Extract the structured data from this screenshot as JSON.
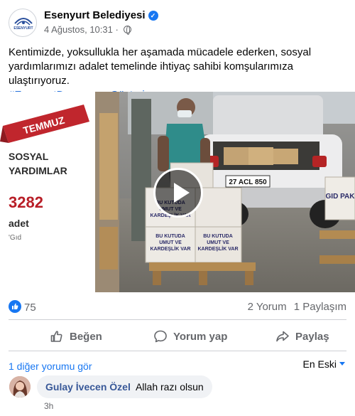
{
  "header": {
    "page_name": "Esenyurt Belediyesi",
    "logo_text": "ESENYURT",
    "timestamp": "4 Ağustos, 10:31",
    "separator": "·"
  },
  "post": {
    "text": "Kentimizde, yoksullukla her aşamada mücadele ederken, sosyal yardımlarımızı adalet temelinde ihtiyaç sahibi komşularımıza ulaştırıyoruz.",
    "hashtag": "#EsenyurtDayanışmaGösteriyor"
  },
  "media": {
    "ribbon": "TEMMUZ",
    "headline_line1": "SOSYAL",
    "headline_line2": "YARDIMLAR",
    "count": "3282",
    "unit": "adet",
    "subtitle": "'Gıd",
    "plate": "27 ACL 850",
    "box_text_1": "BU KUTUDA",
    "box_text_2": "UMUT VE",
    "box_text_3": "KARDEŞLİK VAR",
    "right_box": "GID PAK"
  },
  "stats": {
    "likes": "75",
    "comments": "2 Yorum",
    "shares": "1 Paylaşım"
  },
  "actions": {
    "like": "Beğen",
    "comment": "Yorum yap",
    "share": "Paylaş"
  },
  "comments": {
    "more": "1 diğer yorumu gör",
    "sort": "En Eski",
    "items": [
      {
        "author": "Gulay İvecen Özel",
        "text": "Allah razı olsun",
        "time": "3h"
      }
    ]
  },
  "colors": {
    "accent": "#1877f2",
    "ribbon": "#c0262d",
    "count": "#b81e27"
  }
}
